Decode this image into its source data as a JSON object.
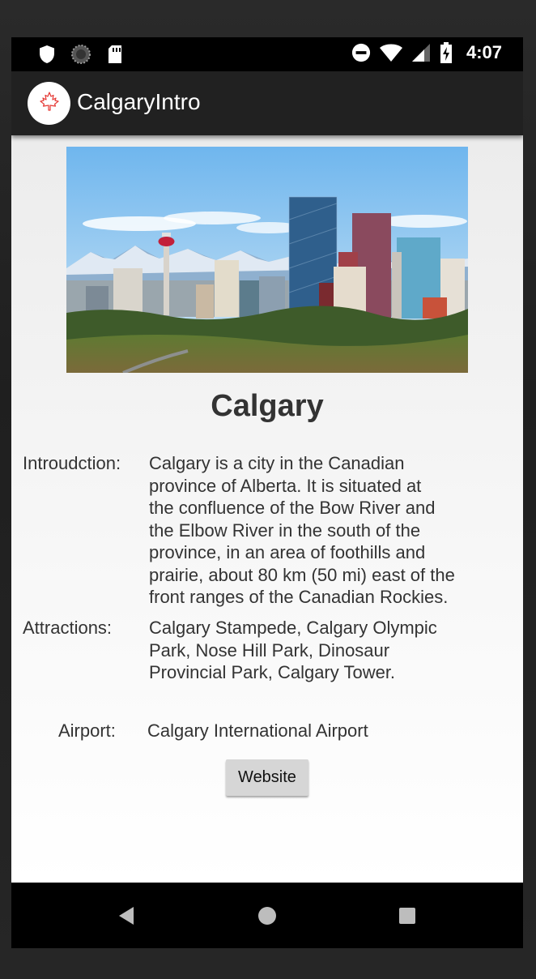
{
  "status_bar": {
    "time": "4:07",
    "icons": [
      "shield-icon",
      "loading-circle-icon",
      "sd-card-icon",
      "do-not-disturb-icon",
      "wifi-icon",
      "cell-signal-icon",
      "battery-charging-icon"
    ]
  },
  "app_bar": {
    "title": "CalgaryIntro",
    "logo_icon": "maple-leaf-icon",
    "logo_color": "#e53935"
  },
  "content": {
    "city_name": "Calgary",
    "introduction": {
      "label": "Introudction:",
      "lines": [
        "Calgary is a city in the Canadian",
        "province of Alberta. It is situated at",
        "the confluence of the Bow River and",
        "the Elbow River in the south of the",
        "province, in an area of foothills and",
        "prairie, about 80 km (50 mi) east of the",
        "front ranges of the Canadian Rockies."
      ]
    },
    "attractions": {
      "label": "Attractions:",
      "lines": [
        "Calgary Stampede, Calgary Olympic",
        "Park, Nose Hill Park, Dinosaur",
        "Provincial Park, Calgary Tower."
      ]
    },
    "airport": {
      "label": "Airport:",
      "value": "Calgary International Airport"
    },
    "website_button": "Website"
  },
  "nav_bar": {
    "back_icon": "back-triangle-icon",
    "home_icon": "home-circle-icon",
    "recents_icon": "recents-square-icon"
  }
}
